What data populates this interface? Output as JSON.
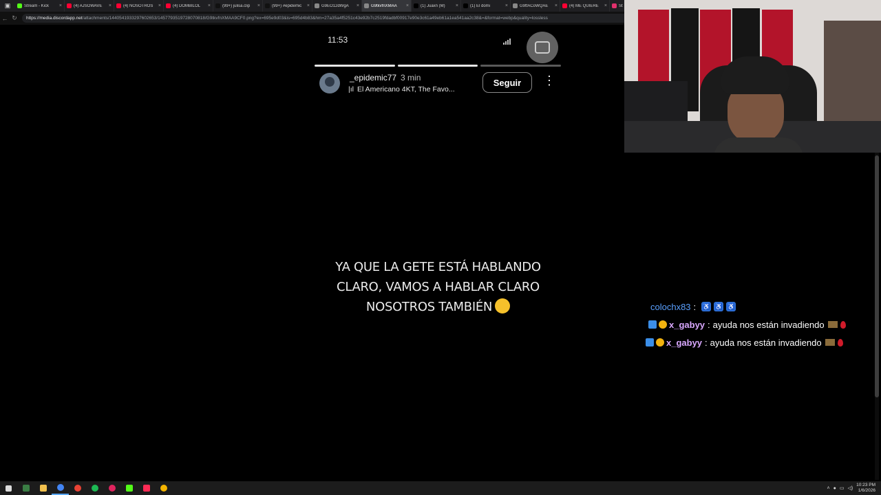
{
  "browser": {
    "tabs": [
      {
        "label": "Stream - Kick",
        "color": "#53fc18",
        "active": false
      },
      {
        "label": "(4) AJSOWAVE",
        "color": "#ff0033",
        "active": false
      },
      {
        "label": "(4) NOSOTROS",
        "color": "#ff0033",
        "active": false
      },
      {
        "label": "(4) DOMBILOL",
        "color": "#ff0033",
        "active": false
      },
      {
        "label": "(99+) julisa.clip",
        "color": "#111111",
        "active": false
      },
      {
        "label": "(99+) #epidemic",
        "color": "#111111",
        "active": false
      },
      {
        "label": "G9EO12dWgA",
        "color": "#888888",
        "active": false
      },
      {
        "label": "G9tkvfnXMAA",
        "color": "#888888",
        "active": true
      },
      {
        "label": "(1) Juaxn (M)",
        "color": "#000000",
        "active": false
      },
      {
        "label": "(1) El domi",
        "color": "#000000",
        "active": false
      },
      {
        "label": "G9tfACoWQAE",
        "color": "#888888",
        "active": false
      },
      {
        "label": "(4) ME QUIERE",
        "color": "#ff0033",
        "active": false
      },
      {
        "label": "St",
        "color": "#e1306c",
        "active": false
      }
    ],
    "url_host": "https://media.discordapp.net",
    "url_path": "/attachments/1440541933297602653/1457793519728070818/G9tkvfnXMAA9CF0.png?ex=695e9d03&is=695d4b83&hm=27a35a4f5251c43e92b7c2519fdadbf00917e90e3c61a49eb61a1ea541aa2c38&=&format=webp&quality=lossless"
  },
  "phone": {
    "time": "11:53",
    "username": "_epidemic77",
    "posted_ago": "3 min",
    "song": "El Americano 4KT, The Favo...",
    "song_icon": "music-bars-icon",
    "follow_label": "Seguir",
    "story_lines": [
      "YA QUE LA GETE ESTÁ HABLANDO",
      "CLARO, VAMOS A HABLAR CLARO",
      "NOSOTROS TAMBIÉN"
    ],
    "progress": [
      1.0,
      1.0,
      0.0
    ],
    "emoji": "smirk-face-emoji"
  },
  "chat": {
    "messages": [
      {
        "user": "colochx83",
        "user_color": "#5aa0ff",
        "text": "",
        "badges": [],
        "extras": "wheelchair-icons"
      },
      {
        "user": "x_gabyy",
        "user_color": "#d9a8ff",
        "text": "ayuda nos están invadiendo",
        "badges": [
          "a",
          "b"
        ],
        "extras": "pin-drop"
      },
      {
        "user": "x_gabyy",
        "user_color": "#d9a8ff",
        "text": "ayuda nos están invadiendo",
        "badges": [
          "a",
          "b"
        ],
        "extras": "pin-drop"
      }
    ]
  },
  "taskbar": {
    "time": "10:23 PM",
    "date": "1/6/2026"
  }
}
